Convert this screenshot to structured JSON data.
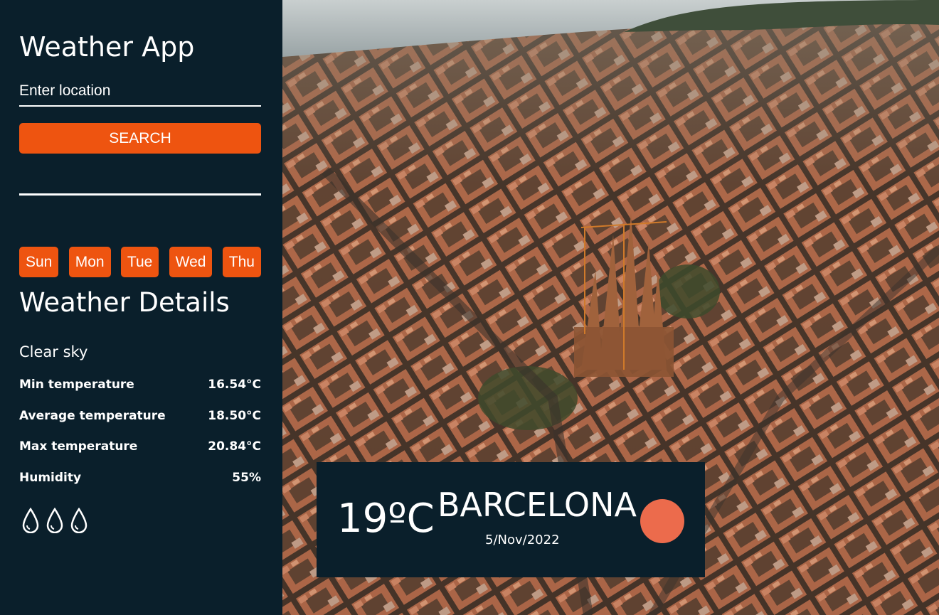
{
  "sidebar": {
    "title": "Weather App",
    "search_placeholder": "Enter location",
    "search_label": "SEARCH",
    "days": [
      "Sun",
      "Mon",
      "Tue",
      "Wed",
      "Thu"
    ],
    "details_title": "Weather Details",
    "condition": "Clear sky",
    "details": [
      {
        "label": "Min temperature",
        "value": "16.54°C"
      },
      {
        "label": "Average temperature",
        "value": "18.50°C"
      },
      {
        "label": "Max temperature",
        "value": "20.84°C"
      },
      {
        "label": "Humidity",
        "value": "55%"
      }
    ],
    "humidity_icons": [
      "droplet-icon",
      "droplet-icon",
      "droplet-icon"
    ]
  },
  "card": {
    "temperature": "19ºC",
    "city": "BARCELONA",
    "date": "5/Nov/2022",
    "icon": "sun-icon"
  },
  "colors": {
    "panel": "#0a1f2b",
    "accent": "#ee5410",
    "sun": "#ec6b4c"
  }
}
